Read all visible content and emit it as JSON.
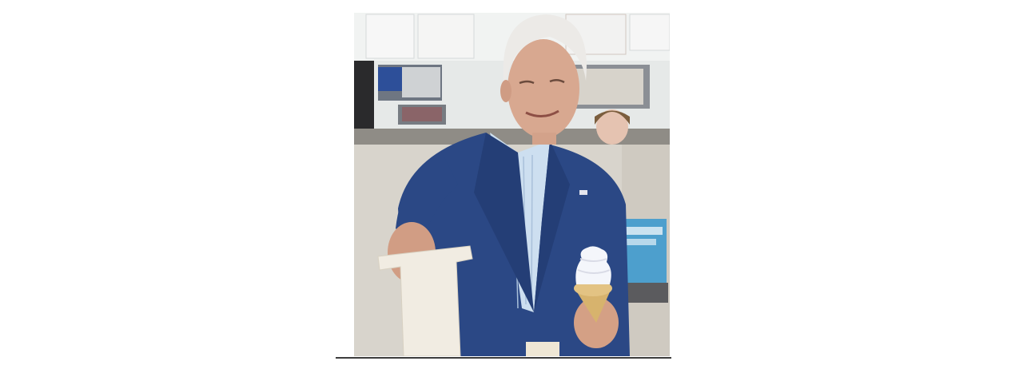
{
  "image": {
    "description_icon": "photo-icon",
    "colors": {
      "background": "#ffffff",
      "wall": "#e9ecea",
      "counter": "#c9c2b4",
      "jacket": "#2c4a86",
      "shirt": "#cfe0ef",
      "skin": "#dcae94",
      "hair": "#eceae7",
      "cone": "#d9b56f",
      "ice_cream": "#f4f6fb"
    }
  }
}
